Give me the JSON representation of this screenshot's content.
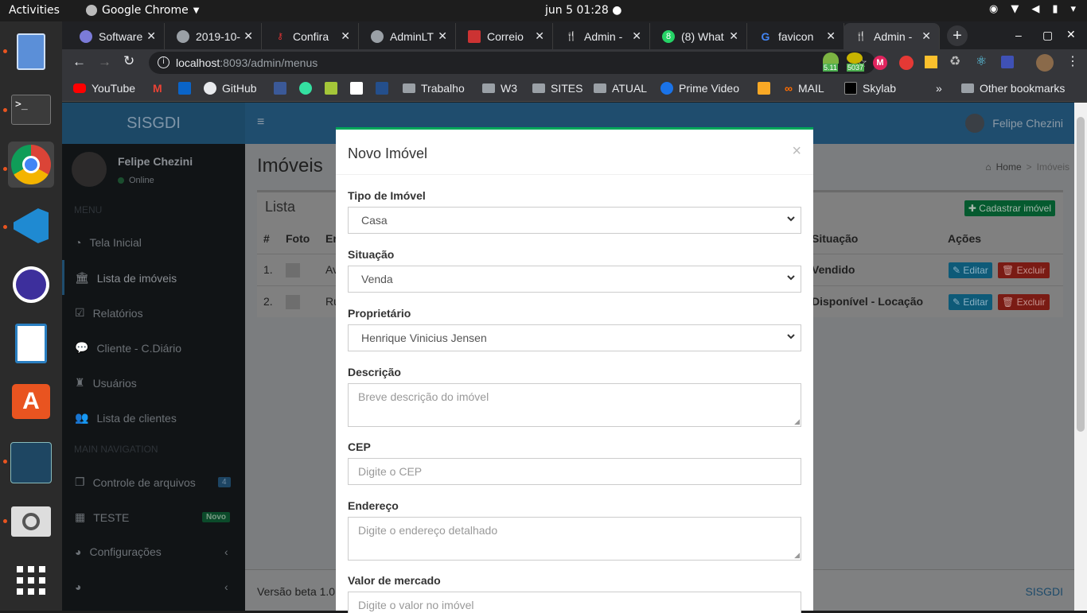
{
  "os": {
    "activities": "Activities",
    "app_name": "Google Chrome",
    "clock": "jun 5  01:28"
  },
  "browser": {
    "tabs": [
      {
        "title": "Software"
      },
      {
        "title": "2019-10-"
      },
      {
        "title": "Confira"
      },
      {
        "title": "AdminLT"
      },
      {
        "title": "Correio"
      },
      {
        "title": "Admin -"
      },
      {
        "title": "(8) What"
      },
      {
        "title": "favicon"
      },
      {
        "title": "Admin -",
        "active": true
      }
    ],
    "url_host": "localhost",
    "url_rest": ":8093/admin/menus",
    "badges": {
      "ext1": "5.11",
      "ext2": "5037"
    },
    "bookmarks": [
      "YouTube",
      "GitHub",
      "Trabalho",
      "W3",
      "SITES",
      "ATUAL",
      "Prime Video",
      "MAIL",
      "Skylab",
      "Other bookmarks"
    ]
  },
  "app": {
    "logo": "SISGDI",
    "user_name": "Felipe Chezini",
    "user_status": "Online",
    "menu_header": "MENU",
    "nav_items": [
      "Tela Inicial",
      "Lista de imóveis",
      "Relatórios",
      "Cliente - C.Diário",
      "Usuários",
      "Lista de clientes"
    ],
    "main_nav_header": "MAIN NAVIGATION",
    "nav_items2": [
      {
        "label": "Controle de arquivos",
        "badge": "4"
      },
      {
        "label": "TESTE",
        "badge": "Novo"
      },
      {
        "label": "Configurações",
        "badge": ""
      }
    ],
    "page_title": "Imóveis",
    "breadcrumb": [
      "Home",
      "Imóveis"
    ],
    "box_title": "Lista",
    "add_button": "Cadastrar imóvel",
    "table_headers": [
      "#",
      "Foto",
      "Er",
      "Situação",
      "Ações"
    ],
    "rows": [
      {
        "num": "1.",
        "name": "Av",
        "status": "Vendido"
      },
      {
        "num": "2.",
        "name": "Ru",
        "status": "Disponível - Locação"
      }
    ],
    "edit_label": "Editar",
    "delete_label": "Excluir",
    "footer_version": "Versão beta 1.0",
    "footer_brand": "SISGDI"
  },
  "modal": {
    "title": "Novo Imóvel",
    "close": "×",
    "fields": {
      "tipo": {
        "label": "Tipo de Imóvel",
        "value": "Casa"
      },
      "situacao": {
        "label": "Situação",
        "value": "Venda"
      },
      "proprietario": {
        "label": "Proprietário",
        "value": "Henrique Vinicius Jensen"
      },
      "descricao": {
        "label": "Descrição",
        "placeholder": "Breve descrição do imóvel"
      },
      "cep": {
        "label": "CEP",
        "placeholder": "Digite o CEP"
      },
      "endereco": {
        "label": "Endereço",
        "placeholder": "Digite o endereço detalhado"
      },
      "valor": {
        "label": "Valor de mercado",
        "placeholder": "Digite o valor no imóvel"
      }
    }
  }
}
